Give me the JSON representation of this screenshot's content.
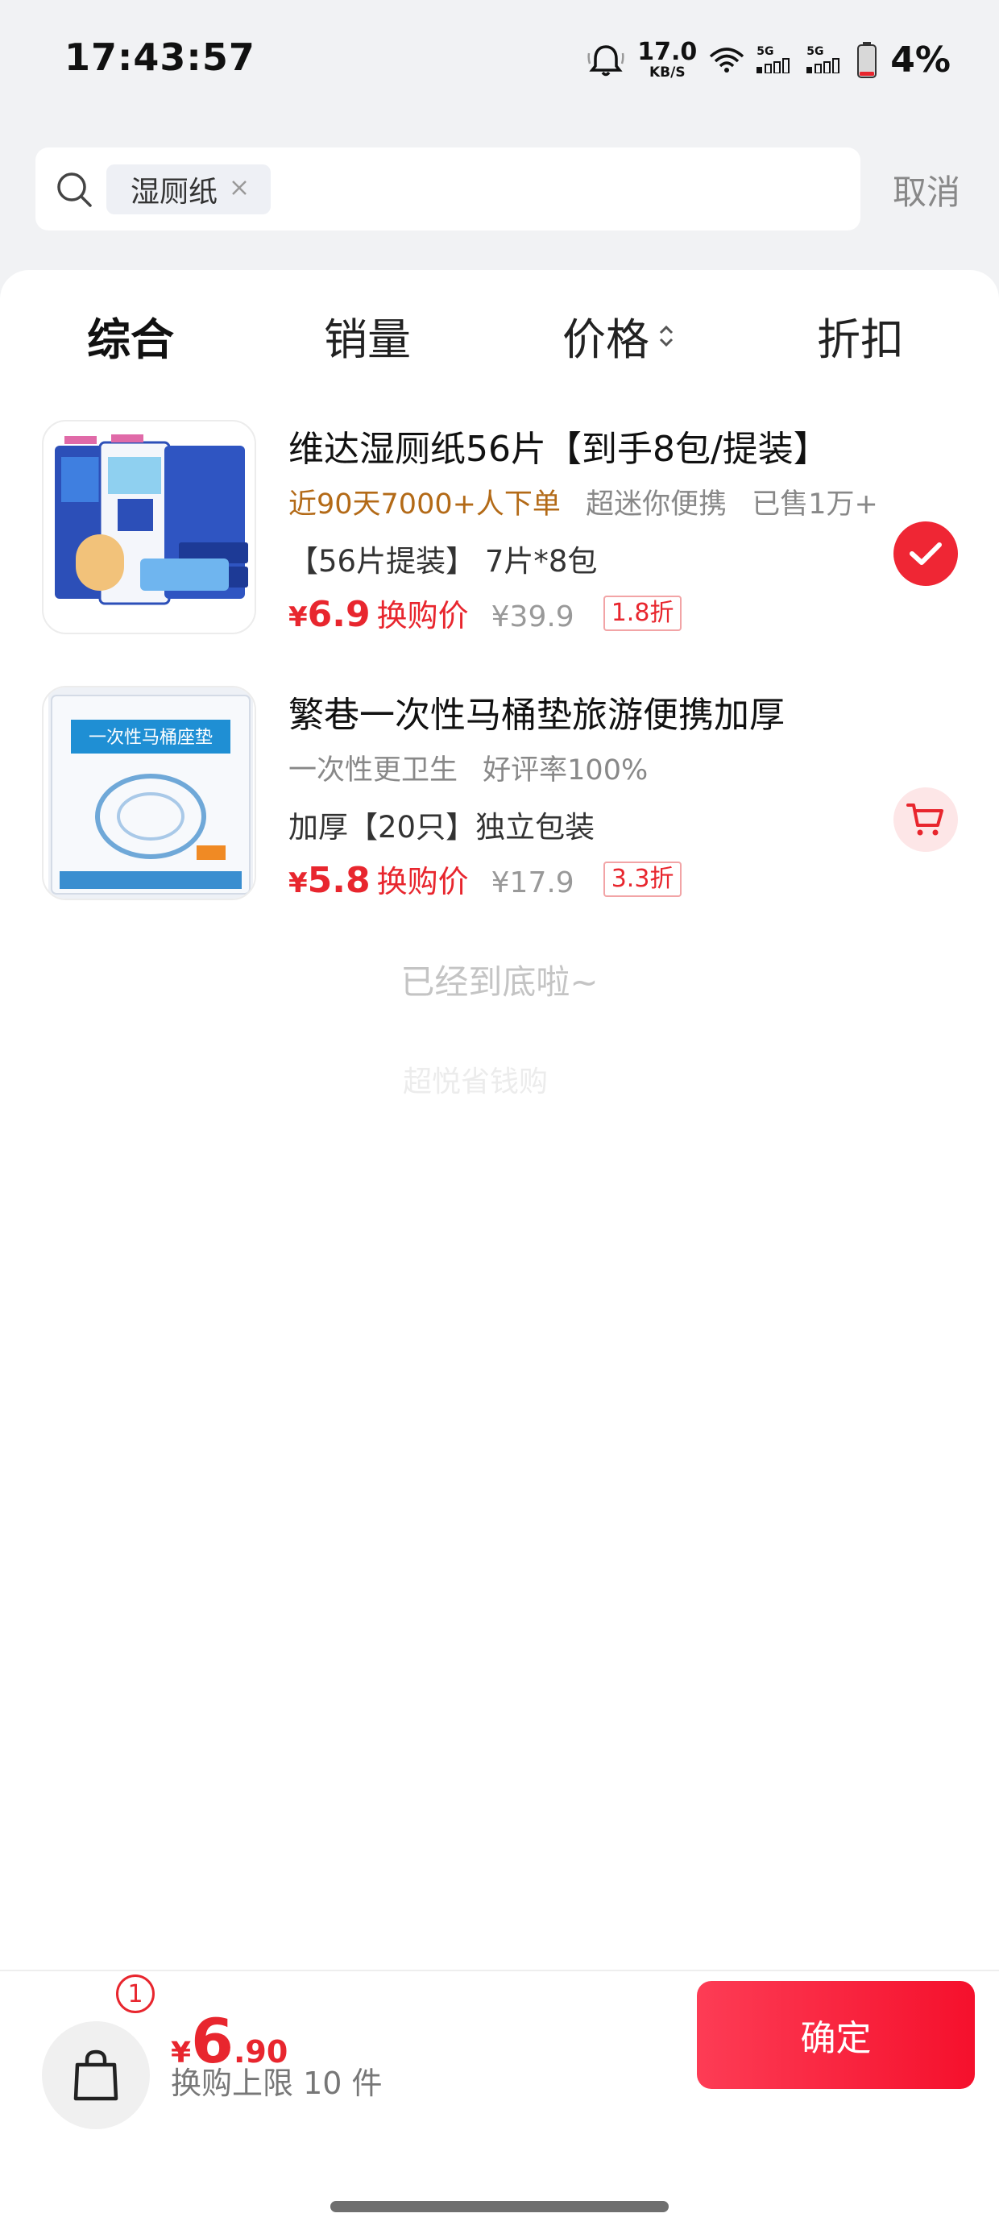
{
  "status_bar": {
    "time": "17:43:57",
    "net_speed_value": "17.0",
    "net_speed_unit": "KB/S",
    "sim1_label": "5G",
    "sim2_label": "5G",
    "battery_percent": "4%",
    "icons": [
      "alarm-icon",
      "wifi-icon",
      "signal-icon",
      "signal-icon",
      "battery-icon"
    ]
  },
  "search": {
    "chip_text": "湿厕纸",
    "cancel_label": "取消"
  },
  "sort_tabs": [
    {
      "label": "综合",
      "active": true
    },
    {
      "label": "销量",
      "active": false
    },
    {
      "label": "价格",
      "active": false
    },
    {
      "label": "折扣",
      "active": false
    }
  ],
  "products": [
    {
      "title": "维达湿厕纸56片【到手8包/提装】",
      "highlight_tag": "近90天7000+人下单",
      "tags": [
        "超迷你便携",
        "已售1万+"
      ],
      "spec": "【56片提装】 7片*8包",
      "currency": "¥",
      "price": "6.9",
      "price_label": "换购价",
      "original_price": "¥39.9",
      "discount": "1.8折",
      "selected": true,
      "thumb_icon": "wet-wipes-pack-icon"
    },
    {
      "title": "繁巷一次性马桶垫旅游便携加厚",
      "highlight_tag": "",
      "tags": [
        "一次性更卫生",
        "好评率100%"
      ],
      "spec": "加厚【20只】独立包装",
      "currency": "¥",
      "price": "5.8",
      "price_label": "换购价",
      "original_price": "¥17.9",
      "discount": "3.3折",
      "selected": false,
      "thumb_icon": "toilet-seat-cover-pack-icon"
    }
  ],
  "end_text": "已经到底啦~",
  "watermark": "超悦省钱购",
  "bottom": {
    "badge_count": "1",
    "currency": "¥",
    "total_int": "6",
    "total_dec": ".90",
    "limit_text": "换购上限 10 件",
    "confirm_label": "确定"
  },
  "colors": {
    "accent_red": "#e8262e",
    "highlight_brown": "#b36a17",
    "confirm_gradient_start": "#fd3c55",
    "confirm_gradient_end": "#f5102c"
  }
}
